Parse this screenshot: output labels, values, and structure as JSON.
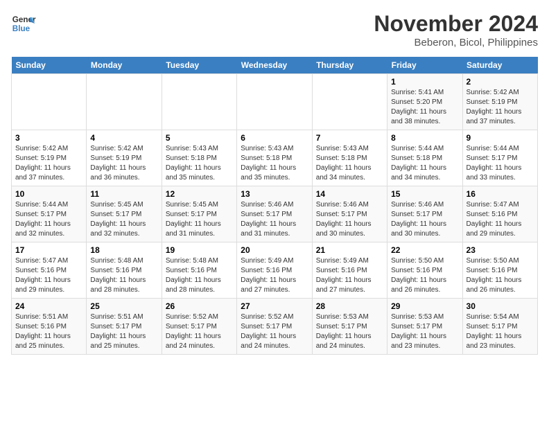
{
  "header": {
    "logo_line1": "General",
    "logo_line2": "Blue",
    "title": "November 2024",
    "subtitle": "Beberon, Bicol, Philippines"
  },
  "calendar": {
    "days_of_week": [
      "Sunday",
      "Monday",
      "Tuesday",
      "Wednesday",
      "Thursday",
      "Friday",
      "Saturday"
    ],
    "weeks": [
      [
        {
          "day": "",
          "info": ""
        },
        {
          "day": "",
          "info": ""
        },
        {
          "day": "",
          "info": ""
        },
        {
          "day": "",
          "info": ""
        },
        {
          "day": "",
          "info": ""
        },
        {
          "day": "1",
          "info": "Sunrise: 5:41 AM\nSunset: 5:20 PM\nDaylight: 11 hours and 38 minutes."
        },
        {
          "day": "2",
          "info": "Sunrise: 5:42 AM\nSunset: 5:19 PM\nDaylight: 11 hours and 37 minutes."
        }
      ],
      [
        {
          "day": "3",
          "info": "Sunrise: 5:42 AM\nSunset: 5:19 PM\nDaylight: 11 hours and 37 minutes."
        },
        {
          "day": "4",
          "info": "Sunrise: 5:42 AM\nSunset: 5:19 PM\nDaylight: 11 hours and 36 minutes."
        },
        {
          "day": "5",
          "info": "Sunrise: 5:43 AM\nSunset: 5:18 PM\nDaylight: 11 hours and 35 minutes."
        },
        {
          "day": "6",
          "info": "Sunrise: 5:43 AM\nSunset: 5:18 PM\nDaylight: 11 hours and 35 minutes."
        },
        {
          "day": "7",
          "info": "Sunrise: 5:43 AM\nSunset: 5:18 PM\nDaylight: 11 hours and 34 minutes."
        },
        {
          "day": "8",
          "info": "Sunrise: 5:44 AM\nSunset: 5:18 PM\nDaylight: 11 hours and 34 minutes."
        },
        {
          "day": "9",
          "info": "Sunrise: 5:44 AM\nSunset: 5:17 PM\nDaylight: 11 hours and 33 minutes."
        }
      ],
      [
        {
          "day": "10",
          "info": "Sunrise: 5:44 AM\nSunset: 5:17 PM\nDaylight: 11 hours and 32 minutes."
        },
        {
          "day": "11",
          "info": "Sunrise: 5:45 AM\nSunset: 5:17 PM\nDaylight: 11 hours and 32 minutes."
        },
        {
          "day": "12",
          "info": "Sunrise: 5:45 AM\nSunset: 5:17 PM\nDaylight: 11 hours and 31 minutes."
        },
        {
          "day": "13",
          "info": "Sunrise: 5:46 AM\nSunset: 5:17 PM\nDaylight: 11 hours and 31 minutes."
        },
        {
          "day": "14",
          "info": "Sunrise: 5:46 AM\nSunset: 5:17 PM\nDaylight: 11 hours and 30 minutes."
        },
        {
          "day": "15",
          "info": "Sunrise: 5:46 AM\nSunset: 5:17 PM\nDaylight: 11 hours and 30 minutes."
        },
        {
          "day": "16",
          "info": "Sunrise: 5:47 AM\nSunset: 5:16 PM\nDaylight: 11 hours and 29 minutes."
        }
      ],
      [
        {
          "day": "17",
          "info": "Sunrise: 5:47 AM\nSunset: 5:16 PM\nDaylight: 11 hours and 29 minutes."
        },
        {
          "day": "18",
          "info": "Sunrise: 5:48 AM\nSunset: 5:16 PM\nDaylight: 11 hours and 28 minutes."
        },
        {
          "day": "19",
          "info": "Sunrise: 5:48 AM\nSunset: 5:16 PM\nDaylight: 11 hours and 28 minutes."
        },
        {
          "day": "20",
          "info": "Sunrise: 5:49 AM\nSunset: 5:16 PM\nDaylight: 11 hours and 27 minutes."
        },
        {
          "day": "21",
          "info": "Sunrise: 5:49 AM\nSunset: 5:16 PM\nDaylight: 11 hours and 27 minutes."
        },
        {
          "day": "22",
          "info": "Sunrise: 5:50 AM\nSunset: 5:16 PM\nDaylight: 11 hours and 26 minutes."
        },
        {
          "day": "23",
          "info": "Sunrise: 5:50 AM\nSunset: 5:16 PM\nDaylight: 11 hours and 26 minutes."
        }
      ],
      [
        {
          "day": "24",
          "info": "Sunrise: 5:51 AM\nSunset: 5:16 PM\nDaylight: 11 hours and 25 minutes."
        },
        {
          "day": "25",
          "info": "Sunrise: 5:51 AM\nSunset: 5:17 PM\nDaylight: 11 hours and 25 minutes."
        },
        {
          "day": "26",
          "info": "Sunrise: 5:52 AM\nSunset: 5:17 PM\nDaylight: 11 hours and 24 minutes."
        },
        {
          "day": "27",
          "info": "Sunrise: 5:52 AM\nSunset: 5:17 PM\nDaylight: 11 hours and 24 minutes."
        },
        {
          "day": "28",
          "info": "Sunrise: 5:53 AM\nSunset: 5:17 PM\nDaylight: 11 hours and 24 minutes."
        },
        {
          "day": "29",
          "info": "Sunrise: 5:53 AM\nSunset: 5:17 PM\nDaylight: 11 hours and 23 minutes."
        },
        {
          "day": "30",
          "info": "Sunrise: 5:54 AM\nSunset: 5:17 PM\nDaylight: 11 hours and 23 minutes."
        }
      ]
    ]
  }
}
